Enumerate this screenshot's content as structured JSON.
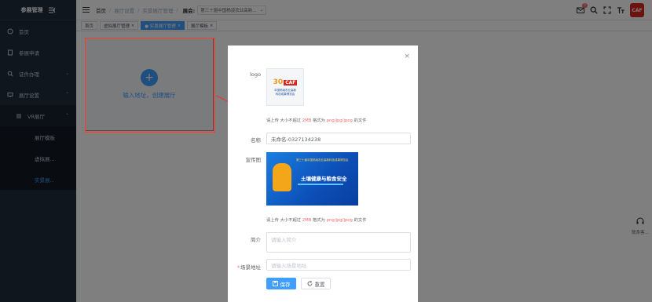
{
  "sidebar": {
    "title": "参展管理",
    "items": [
      {
        "label": "首页"
      },
      {
        "label": "参展申请"
      },
      {
        "label": "证件办理"
      },
      {
        "label": "展厅设置"
      },
      {
        "label": "VR展厅"
      },
      {
        "label": "展厅模板"
      },
      {
        "label": "虚拟展..."
      },
      {
        "label": "实景展..."
      }
    ]
  },
  "header": {
    "breadcrumbs": [
      "首页",
      "展厅设置",
      "实景展厅管理"
    ],
    "exhibit_label": "展会:",
    "exhibit_value": "第三十届中国杨凌农业高新...",
    "notification_count": "5",
    "avatar_text": "CAF"
  },
  "tags": [
    {
      "label": "首页"
    },
    {
      "label": "虚拟展厅管理"
    },
    {
      "label": "● 实景展厅管理"
    },
    {
      "label": "展厅模板"
    }
  ],
  "content": {
    "create_text": "输入地址，创建展厅"
  },
  "dialog": {
    "logo_label": "logo",
    "logo_brand": "CAF",
    "logo_mark": "30",
    "logo_caption_1": "中国杨凌农业高新",
    "logo_caption_2": "科技成果博览会",
    "upload_tip_prefix": "请上传 大小不超过",
    "upload_tip_size": "2MB",
    "upload_tip_mid": "格式为",
    "upload_tip_formats": "png/jpg/jpeg",
    "upload_tip_suffix": "的文件",
    "name_label": "名称",
    "name_value": "未命名-0327134238",
    "poster_label": "宣传图",
    "poster_title": "土壤健康与粮食安全",
    "poster_sub": "第三十届中国杨凌农业高新科技成果博览会",
    "intro_label": "简介",
    "intro_placeholder": "请输入简介",
    "scene_label": "场景地址",
    "scene_placeholder": "请输入场景地址",
    "save_label": "保存",
    "reset_label": "重置"
  },
  "support": {
    "label": "联系客..."
  },
  "colors": {
    "primary": "#409eff",
    "danger": "#f56c6c",
    "sidebar_bg": "#1f2d3d"
  }
}
